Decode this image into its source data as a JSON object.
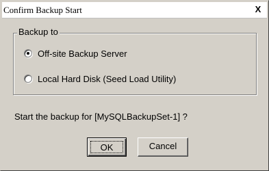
{
  "window": {
    "title": "Confirm Backup Start",
    "close_glyph": "X"
  },
  "group": {
    "label": "Backup to",
    "options": [
      {
        "label": "Off-site Backup Server",
        "selected": true
      },
      {
        "label": "Local Hard Disk (Seed Load Utility)",
        "selected": false
      }
    ]
  },
  "prompt": "Start the backup for [MySQLBackupSet-1] ?",
  "buttons": {
    "ok_label": "OK",
    "cancel_label": "Cancel"
  }
}
